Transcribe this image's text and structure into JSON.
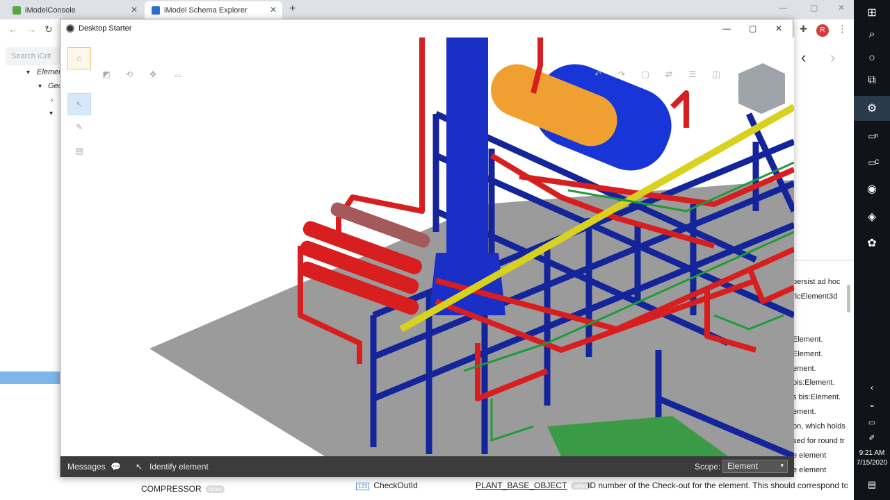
{
  "browser": {
    "tabs": [
      {
        "label": "iModelConsole"
      },
      {
        "label": "iModel Schema Explorer"
      }
    ],
    "new_tab": "+",
    "avatar_initial": "R"
  },
  "left_panel": {
    "search_placeholder": "Search iCrit",
    "tree": [
      {
        "label": "Element"
      },
      {
        "label": "Geo"
      }
    ]
  },
  "window": {
    "title": "Desktop Starter",
    "statusbar": {
      "messages_label": "Messages",
      "prompt": "Identify element",
      "scope_label": "Scope:",
      "scope_value": "Element"
    }
  },
  "right_panel": {
    "lines": [
      "persist ad hoc",
      "ricElement3d",
      "Element.",
      "Element.",
      "ement.",
      "bis:Element.",
      "s bis:Element.",
      "ement.",
      "on, which holds",
      "sed for round tr",
      "e element",
      "e element"
    ]
  },
  "bottom_row": {
    "compressor_label": "COMPRESSOR",
    "compressor_pill": "oplus",
    "badge": "123",
    "checkout_label": "CheckOutId",
    "plant_base": "PLANT_BASE_OBJECT",
    "plant_pill": "oplus",
    "description": "ID number of the Check-out for the element. This should correspond to ar"
  },
  "taskbar": {
    "apps": [
      {
        "label": "n"
      },
      {
        "label": "C"
      }
    ],
    "time": "9:21 AM",
    "date": "7/15/2020"
  },
  "colors": {
    "steel_blue": "#14249a",
    "pipe_red": "#d81e1e",
    "vessel_orange": "#f0a030",
    "pipe_yellow": "#d8d21e",
    "pipe_green": "#1e9a3a",
    "floor_gray": "#9b9b9b"
  }
}
